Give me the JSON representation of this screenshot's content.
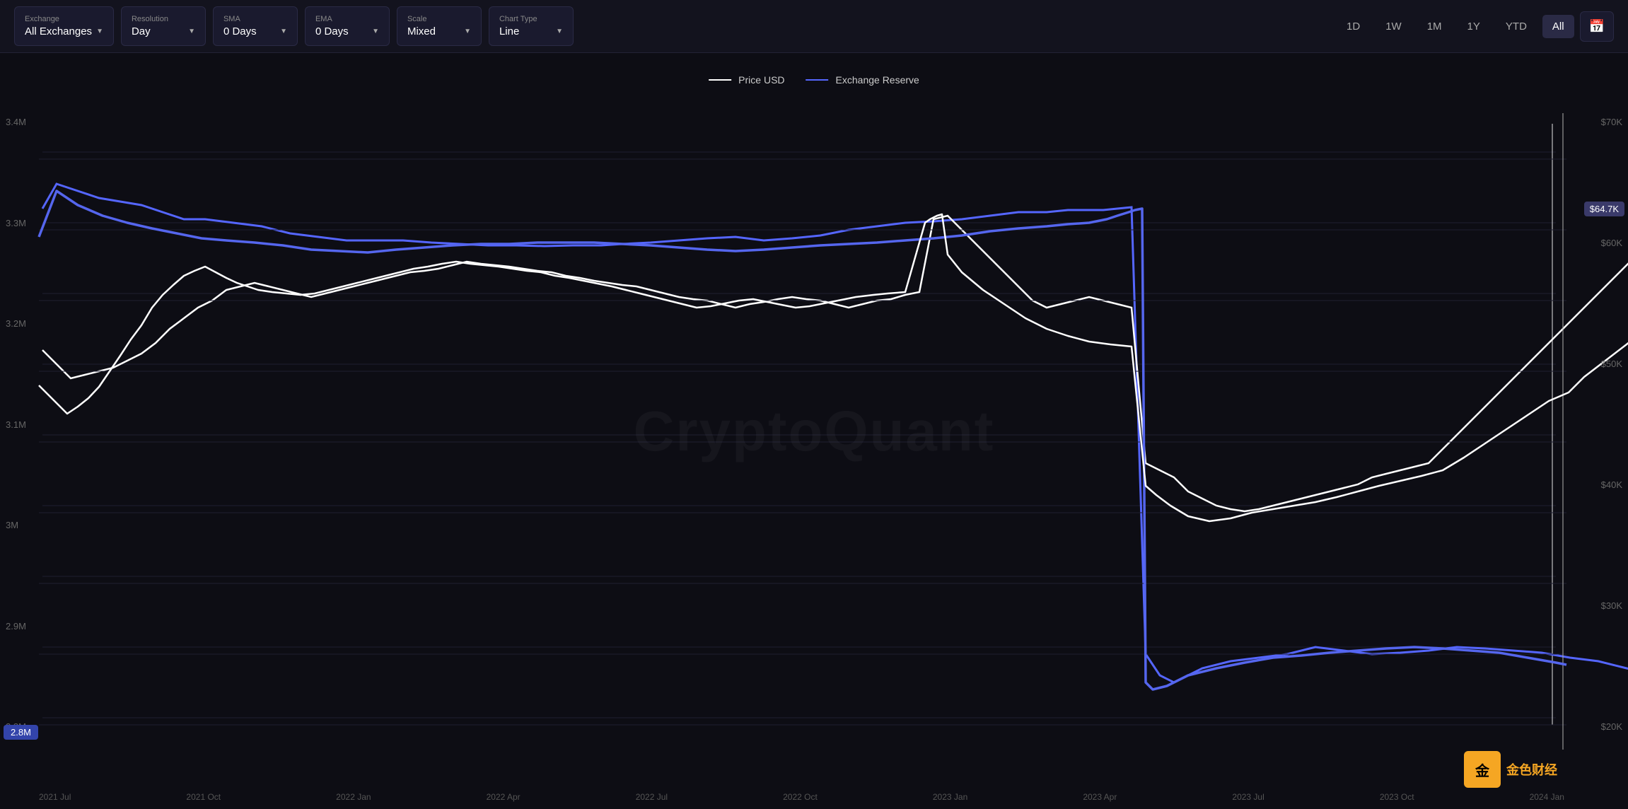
{
  "toolbar": {
    "exchange": {
      "label": "Exchange",
      "value": "All Exchanges"
    },
    "resolution": {
      "label": "Resolution",
      "value": "Day"
    },
    "sma": {
      "label": "SMA",
      "value": "0 Days"
    },
    "ema": {
      "label": "EMA",
      "value": "0 Days"
    },
    "scale": {
      "label": "Scale",
      "value": "Mixed"
    },
    "chartType": {
      "label": "Chart Type",
      "value": "Line"
    }
  },
  "timeButtons": [
    "1D",
    "1W",
    "1M",
    "1Y",
    "YTD",
    "All"
  ],
  "activeTimeButton": "All",
  "legend": {
    "priceLabel": "Price USD",
    "reserveLabel": "Exchange Reserve"
  },
  "yAxisLeft": [
    "3.4M",
    "3.3M",
    "3.2M",
    "3.1M",
    "3M",
    "2.9M",
    "2.8M"
  ],
  "yAxisRight": [
    "$70K",
    "$60K",
    "$50K",
    "$40K",
    "$30K",
    "$20K"
  ],
  "xAxisLabels": [
    "2021 Jul",
    "2021 Oct",
    "2022 Jan",
    "2022 Apr",
    "2022 Jul",
    "2022 Oct",
    "2023 Jan",
    "2023 Apr",
    "2023 Jul",
    "2023 Oct",
    "2024 Jan"
  ],
  "currentPrice": "$64.7K",
  "currentReserve": "2.8M",
  "watermark": "CryptoQuant",
  "logo": {
    "icon": "金",
    "text": "金色财经"
  }
}
